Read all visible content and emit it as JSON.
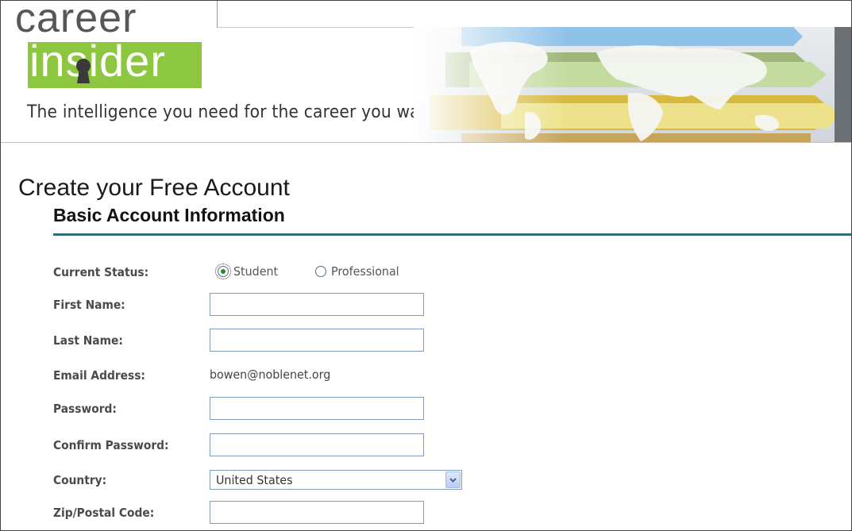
{
  "header": {
    "logo_top": "career",
    "logo_bottom": "insider",
    "tagline": "The intelligence you need for the career you want."
  },
  "page": {
    "title": "Create your Free Account",
    "section_title": "Basic Account Information"
  },
  "form": {
    "status": {
      "label": "Current Status:",
      "options": [
        "Student",
        "Professional"
      ],
      "selected": "Student"
    },
    "first_name": {
      "label": "First Name:",
      "value": ""
    },
    "last_name": {
      "label": "Last Name:",
      "value": ""
    },
    "email": {
      "label": "Email Address:",
      "value": "bowen@noblenet.org"
    },
    "password": {
      "label": "Password:",
      "value": ""
    },
    "confirm_password": {
      "label": "Confirm Password:",
      "value": ""
    },
    "country": {
      "label": "Country:",
      "value": "United States"
    },
    "zip": {
      "label": "Zip/Postal Code:",
      "value": ""
    }
  },
  "colors": {
    "brand_green": "#8dc63f",
    "logo_gray": "#555759",
    "section_rule": "#2f6f7a",
    "input_border": "#7f9db9"
  },
  "icons": {
    "select_arrow": "chevron-down-icon",
    "logo_keyhole": "keyhole-icon"
  }
}
